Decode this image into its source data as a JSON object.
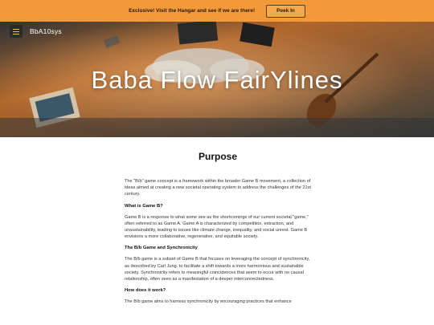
{
  "announcement": {
    "text": "Exclusive! Visit the Hangar and see if we are there!",
    "button_label": "Peek In"
  },
  "header": {
    "brand": "BbA10sys",
    "hero_title": "Baba Flow FairYlines"
  },
  "colors": {
    "announcement_bg": "#f29a3a",
    "hero_accent": "#d9822b",
    "menu_icon_lines": "#e8c24a"
  },
  "main": {
    "title": "Purpose",
    "sections": [
      {
        "type": "paragraph",
        "text": "The \"B/b\" game concept is a framework within the broader Game B movement, a collection of ideas aimed at creating a new societal operating system to address the challenges of the 21st century."
      },
      {
        "type": "heading",
        "text": "What is Game B?"
      },
      {
        "type": "paragraph",
        "text": "Game B is a response to what some see as the shortcomings of our current societal \"game,\" often referred to as Game A. Game A is characterized by competition, extraction, and unsustainability, leading to issues like climate change, inequality, and social unrest. Game B envisions a more collaborative, regenerative, and equitable society."
      },
      {
        "type": "heading",
        "text": "The B/b Game and Synchronicity"
      },
      {
        "type": "paragraph",
        "text": "The B/b game is a subset of Game B that focuses on leveraging the concept of synchronicity, as described by Carl Jung, to facilitate a shift towards a more harmonious and sustainable society. Synchronicity refers to meaningful coincidences that seem to occur with no causal relationship, often seen as a manifestation of a deeper interconnectedness."
      },
      {
        "type": "heading",
        "text": "How does it work?"
      },
      {
        "type": "paragraph",
        "text": "The B/b game aims to harness synchronicity by encouraging practices that enhance"
      }
    ]
  }
}
